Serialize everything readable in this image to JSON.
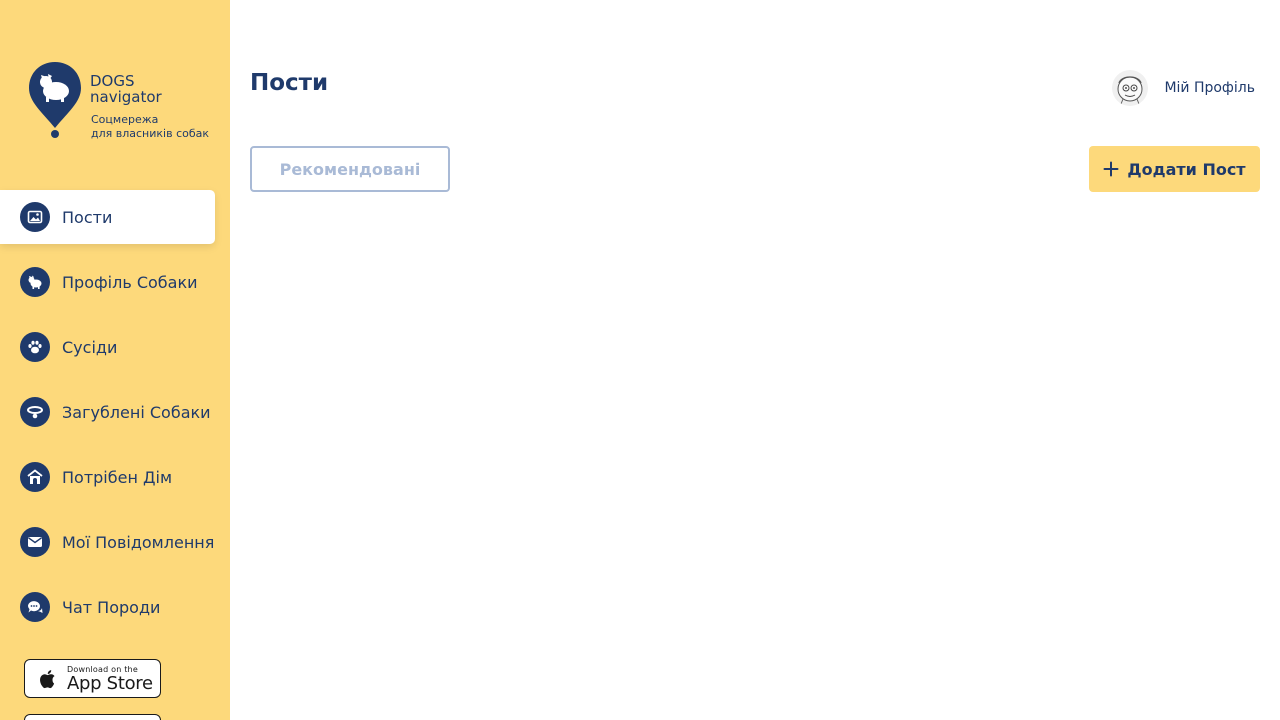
{
  "logo": {
    "title_line1": "DOGS",
    "title_line2": "navigator",
    "subtitle_line1": "Соцмережа",
    "subtitle_line2": "для власників собак"
  },
  "nav": {
    "items": [
      {
        "label": "Пости",
        "icon": "image-icon",
        "active": true
      },
      {
        "label": "Профіль Собаки",
        "icon": "dog-icon",
        "active": false
      },
      {
        "label": "Сусіди",
        "icon": "paw-icon",
        "active": false
      },
      {
        "label": "Загублені Собаки",
        "icon": "collar-icon",
        "active": false
      },
      {
        "label": "Потрібен Дім",
        "icon": "dog-house-icon",
        "active": false
      },
      {
        "label": "Мої Повідомлення",
        "icon": "envelope-icon",
        "active": false
      },
      {
        "label": "Чат Породи",
        "icon": "chat-icon",
        "active": false
      }
    ]
  },
  "store": {
    "appstore_small": "Download on the",
    "appstore_big": "App Store"
  },
  "header": {
    "title": "Пости",
    "profile_label": "Мій Профіль"
  },
  "toolbar": {
    "recommended_label": "Рекомендовані",
    "add_post_label": "Додати Пост"
  },
  "colors": {
    "sidebar_bg": "#fdd97b",
    "brand_navy": "#1f3a6b",
    "muted_blue": "#a9bad6"
  }
}
